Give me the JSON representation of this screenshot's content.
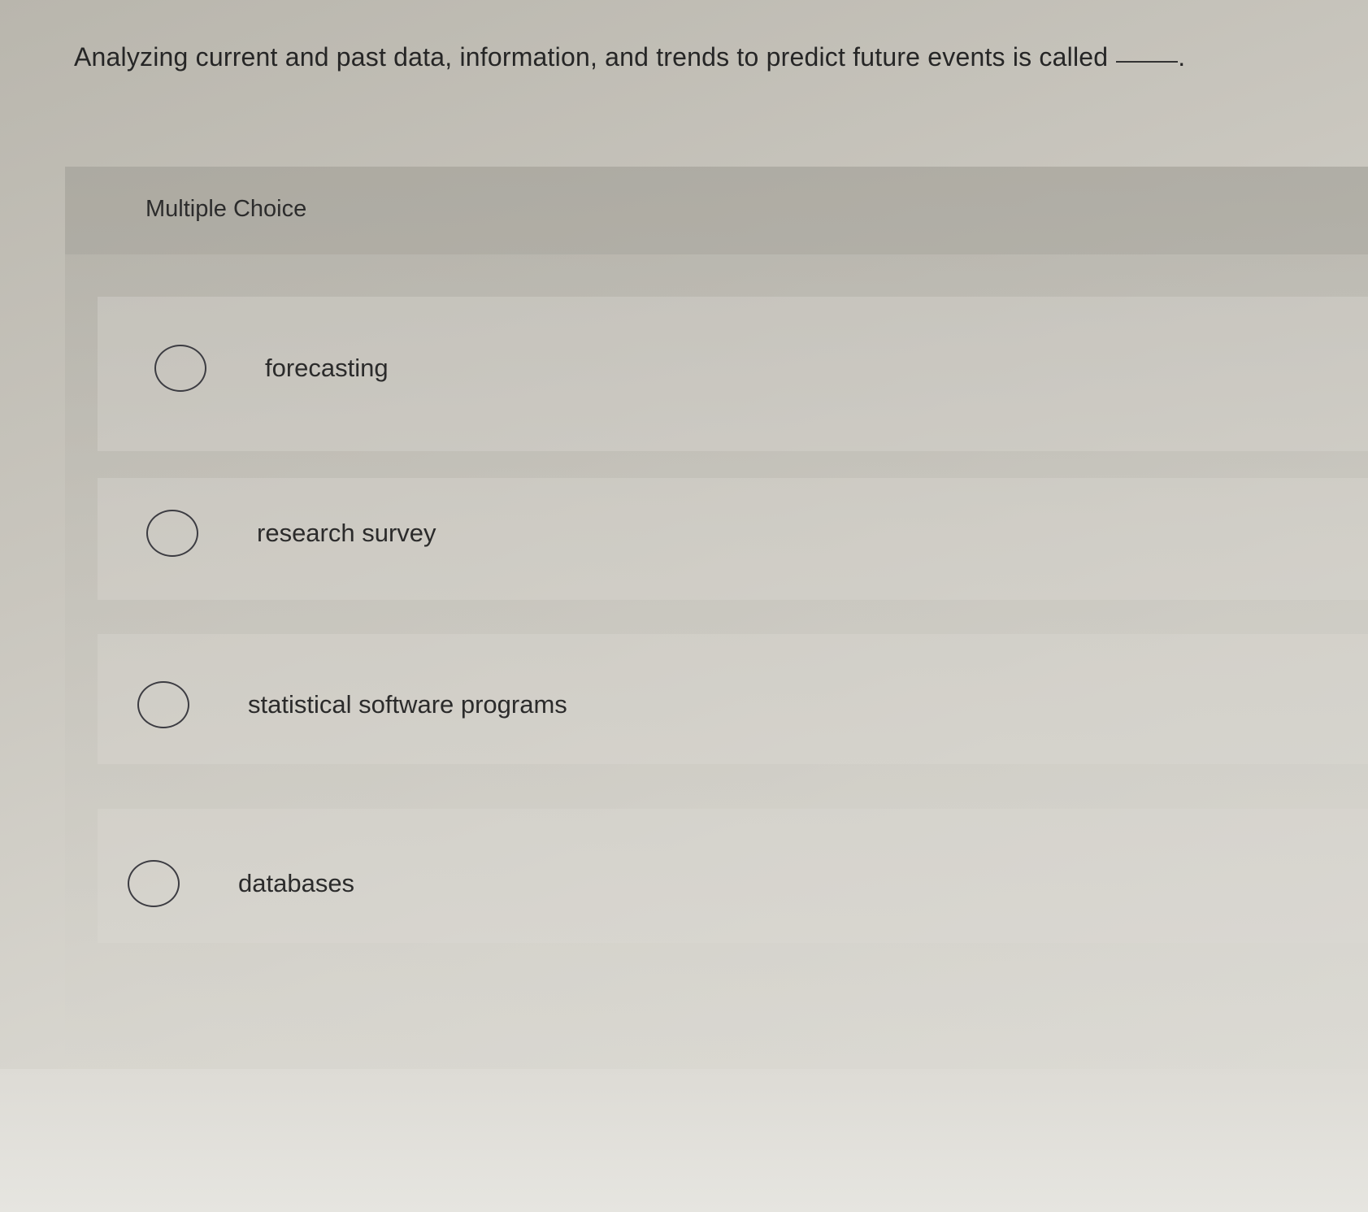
{
  "question": {
    "text": "Analyzing current and past data, information, and trends to predict future events is called",
    "blank_suffix": "."
  },
  "panel": {
    "title": "Multiple Choice"
  },
  "choices": [
    {
      "label": "forecasting",
      "selected": false
    },
    {
      "label": "research survey",
      "selected": false
    },
    {
      "label": "statistical software programs",
      "selected": false
    },
    {
      "label": "databases",
      "selected": false
    }
  ],
  "colors": {
    "text": "#2b2b2b",
    "radio_border": "#3c3c42"
  }
}
